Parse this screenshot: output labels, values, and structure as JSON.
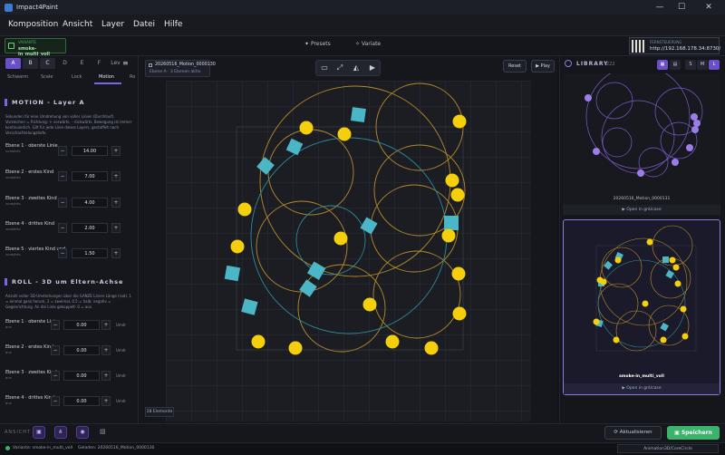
{
  "window": {
    "title": "Impact4Paint",
    "controls": [
      "—",
      "☐",
      "✕"
    ]
  },
  "menu": [
    "Komposition",
    "Ansicht",
    "Layer",
    "Datei",
    "Hilfe"
  ],
  "top": {
    "variant_small": "VARIANTE",
    "variant_name": "smoke-in_multi_voll",
    "presets_label": "Presets",
    "variate_label": "Variate",
    "ip_label": "FERNSTEUERUNG",
    "ip": "http://192.168.178.34:8730/"
  },
  "left": {
    "layer_tabs": [
      "A",
      "B",
      "C",
      "D",
      "E",
      "F",
      "Lev"
    ],
    "subtabs": [
      "Schwarm",
      "Scale",
      "Lock",
      "Motion",
      "Ro"
    ],
    "motion_title": "MOTION - Layer A",
    "motion_desc": "Sekunden für eine Umdrehung von voller Linien (Durchlauf). Vorzeichen = Richtung: + vorwärts, - rückwärts. Bewegung ist immer kontinuierlich. Gilt für jede Linie dieses Layers, gestaffelt nach Verschachtelungstiefe.",
    "motion_rows": [
      {
        "label": "Ebene 1 · oberste Linie",
        "sub": "vorwärts",
        "value": "14.00"
      },
      {
        "label": "Ebene 2 · erstes Kind",
        "sub": "vorwärts",
        "value": "7.00"
      },
      {
        "label": "Ebene 3 · zweites Kind",
        "sub": "vorwärts",
        "value": "4.00"
      },
      {
        "label": "Ebene 4 · drittes Kind",
        "sub": "vorwärts",
        "value": "2.00"
      },
      {
        "label": "Ebene 5 · viertes Kind und",
        "sub": "vorwärts",
        "value": "1.50"
      }
    ],
    "roll_title": "ROLL - 3D um Eltern-Achse",
    "roll_desc": "Anzahl voller 3D-Umdrehungen über die GANZE Linien-Länge (rad). 1 = einmal ganz herum, 2 = zweimal, 0.5 = halb; negativ = Gegenrichtung. An die Linie gekoppelt: 0 = aus.",
    "roll_rows": [
      {
        "label": "Ebene 1 · oberste Linie",
        "sub": "aus",
        "value": "0.00",
        "unit": "Umdr"
      },
      {
        "label": "Ebene 2 · erstes Kind",
        "sub": "aus",
        "value": "0.00",
        "unit": "Umdr"
      },
      {
        "label": "Ebene 3 · zweites Kind",
        "sub": "aus",
        "value": "0.00",
        "unit": "Umdr"
      },
      {
        "label": "Ebene 4 · drittes Kind",
        "sub": "aus",
        "value": "0.00",
        "unit": "Umdr"
      }
    ]
  },
  "canvas": {
    "info_title": "20260516_Motion_0000130",
    "info_sub": "Ebene A · 3 Ebenen aktiv",
    "reset_label": "Reset",
    "play_label": "Play",
    "count_label": "28 Elemente",
    "colors": {
      "circle": "#b58b2a",
      "ring": "#2d8c99",
      "dot": "#f5cf0c",
      "square": "#4ab6c6",
      "bounds": "#3a3d48"
    }
  },
  "library": {
    "title": "LIBRARY",
    "count": "222",
    "sizes": [
      "S",
      "M",
      "L"
    ],
    "card1_label": "20260516_Motion_0000131",
    "card1_open": "Open in gnUcase",
    "card2_label": "smoke-in_multi_voll",
    "card2_open": "Open in gnUcase"
  },
  "bottom": {
    "ansicht": "ANSICHT",
    "aktualisieren": "Aktualisieren",
    "speichern": "Speichern"
  },
  "status": {
    "variant": "Variante: smoke-in_multi_voll",
    "loaded": "Geladen: 20260516_Motion_0000130",
    "right": "Animation3D/CoreCircle"
  }
}
